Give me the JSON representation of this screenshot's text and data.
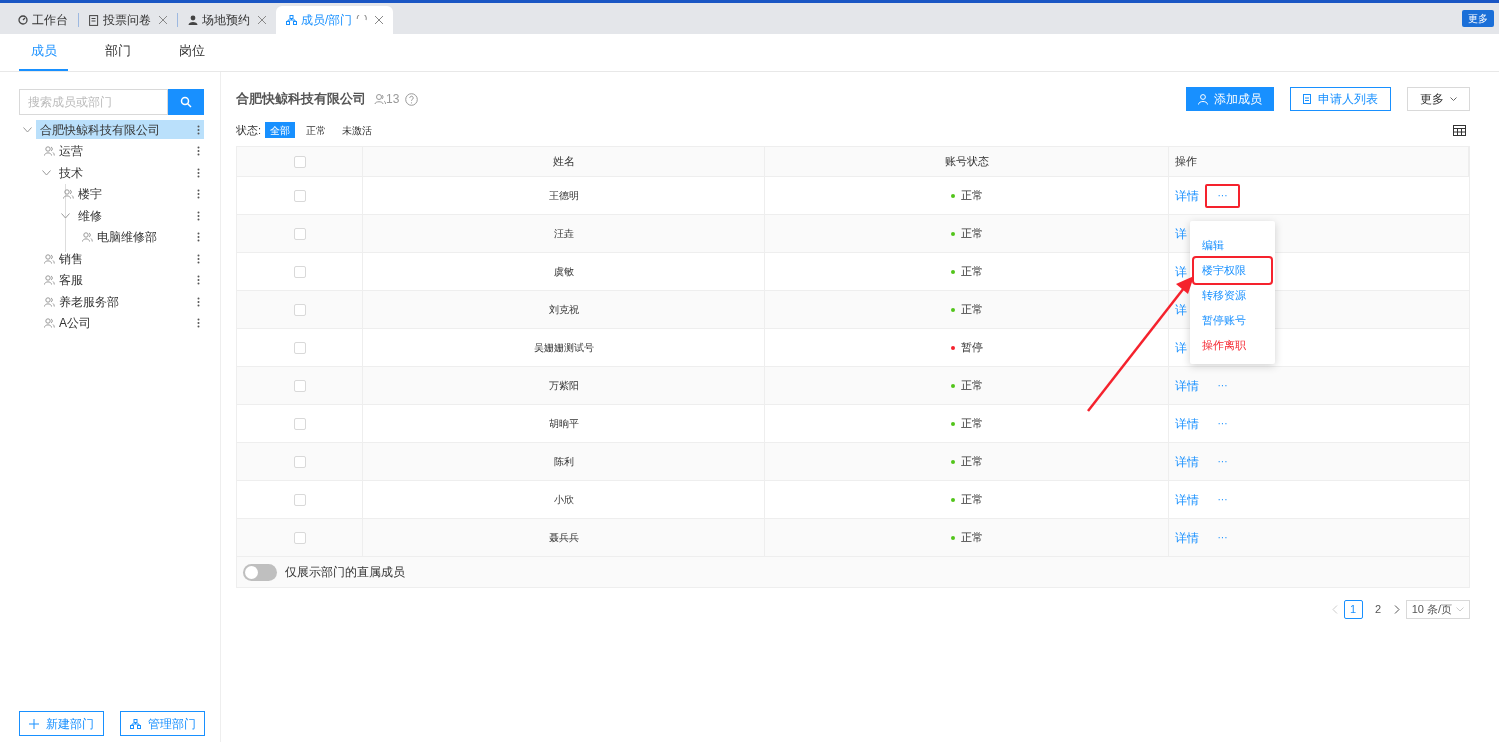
{
  "top_tabs": [
    {
      "label": "工作台",
      "closable": false,
      "selected": false
    },
    {
      "label": "投票问卷",
      "closable": true,
      "selected": false
    },
    {
      "label": "场地预约",
      "closable": true,
      "selected": false
    },
    {
      "label": "成员/部门",
      "closable": true,
      "selected": true
    }
  ],
  "more_tabs_button": "更多",
  "sub_tabs": [
    {
      "label": "成员",
      "selected": true
    },
    {
      "label": "部门",
      "selected": false
    },
    {
      "label": "岗位",
      "selected": false
    }
  ],
  "search": {
    "placeholder": "搜索成员或部门"
  },
  "tree": [
    {
      "label": "合肥快鲸科技有限公司",
      "expanded": true,
      "selected": true,
      "children": [
        {
          "label": "运营",
          "selected": false
        },
        {
          "label": "技术",
          "expanded": true,
          "selected": false,
          "children": [
            {
              "label": "楼宇",
              "selected": false
            },
            {
              "label": "维修",
              "expanded": true,
              "selected": false,
              "children": [
                {
                  "label": "电脑维修部",
                  "selected": false
                }
              ]
            }
          ]
        },
        {
          "label": "销售",
          "selected": false
        },
        {
          "label": "客服",
          "selected": false
        },
        {
          "label": "养老服务部",
          "selected": false
        },
        {
          "label": "A公司",
          "selected": false
        }
      ]
    }
  ],
  "left_buttons": [
    {
      "label": "新建部门"
    },
    {
      "label": "管理部门"
    }
  ],
  "company": {
    "name": "合肥快鲸科技有限公司",
    "member_count": "13"
  },
  "actions": [
    {
      "label": "添加成员",
      "kind": "primary"
    },
    {
      "label": "申请人列表",
      "kind": "outline"
    },
    {
      "label": "更多",
      "kind": "dropdown"
    }
  ],
  "filter": {
    "label": "状态:",
    "options": [
      {
        "label": "全部",
        "selected": true
      },
      {
        "label": "正常",
        "selected": false
      },
      {
        "label": "未激活",
        "selected": false
      }
    ]
  },
  "table": {
    "all_checked": false,
    "columns": [
      "姓名",
      "账号状态",
      "操作"
    ],
    "rows": [
      {
        "name": "王德明",
        "status": "正常",
        "color": "#52c41a",
        "checked": false,
        "detail": "详情",
        "more": "···",
        "highlighted": true
      },
      {
        "name": "汪垚",
        "status": "正常",
        "color": "#52c41a",
        "checked": false,
        "detail": "详"
      },
      {
        "name": "虞敏",
        "status": "正常",
        "color": "#52c41a",
        "checked": false,
        "detail": "详"
      },
      {
        "name": "刘克祝",
        "status": "正常",
        "color": "#52c41a",
        "checked": false,
        "detail": "详"
      },
      {
        "name": "吴姗姗测试号",
        "status": "暂停",
        "color": "#f5222d",
        "checked": false,
        "detail": "详"
      },
      {
        "name": "万紫阳",
        "status": "正常",
        "color": "#52c41a",
        "checked": false,
        "detail": "详情",
        "more": "···",
        "highlighted": false
      },
      {
        "name": "胡晌平",
        "status": "正常",
        "color": "#52c41a",
        "checked": false,
        "detail": "详情",
        "more": "···",
        "highlighted": false
      },
      {
        "name": "陈利",
        "status": "正常",
        "color": "#52c41a",
        "checked": false,
        "detail": "详情",
        "more": "···",
        "highlighted": false
      },
      {
        "name": "小欣",
        "status": "正常",
        "color": "#52c41a",
        "checked": false,
        "detail": "详情",
        "more": "···",
        "highlighted": false
      },
      {
        "name": "聂兵兵",
        "status": "正常",
        "color": "#52c41a",
        "checked": false,
        "detail": "详情",
        "more": "···",
        "highlighted": false
      }
    ],
    "footer_toggle": {
      "label": "仅展示部门的直属成员",
      "on": false
    }
  },
  "row_menu": [
    {
      "label": "编辑",
      "kind": "normal",
      "highlighted": false
    },
    {
      "label": "楼宇权限",
      "kind": "normal",
      "highlighted": true
    },
    {
      "label": "转移资源",
      "kind": "normal",
      "highlighted": false
    },
    {
      "label": "暂停账号",
      "kind": "normal",
      "highlighted": false
    },
    {
      "label": "操作离职",
      "kind": "danger",
      "highlighted": false
    }
  ],
  "pagination": {
    "pages": [
      {
        "label": "1",
        "selected": true
      },
      {
        "label": "2",
        "selected": false
      }
    ],
    "page_size": "10 条/页"
  }
}
